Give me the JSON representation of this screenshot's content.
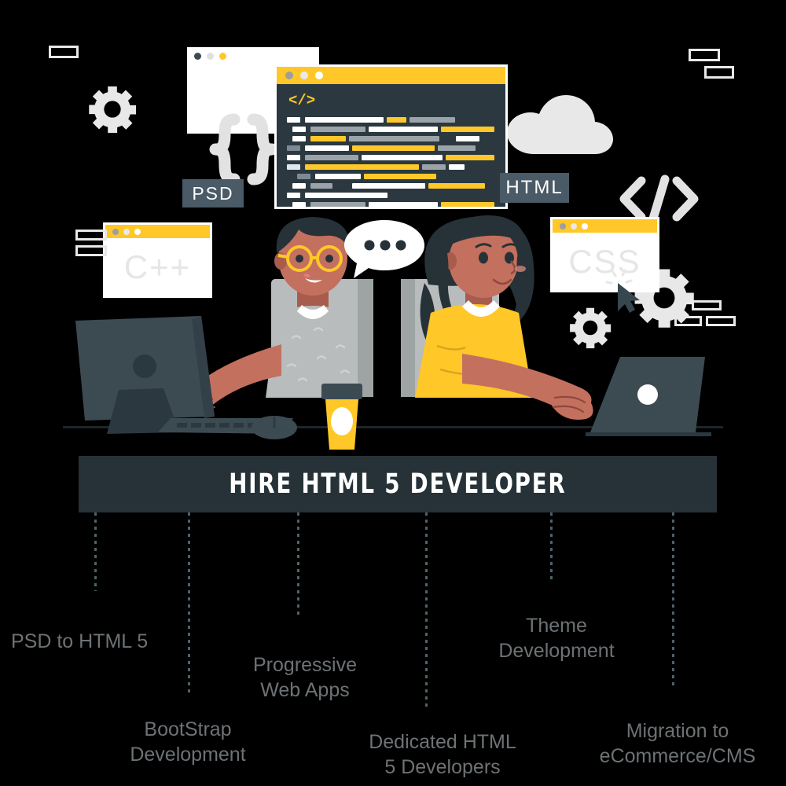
{
  "title_bar": {
    "text": "HIRE  HTML  5  DEVELOPER"
  },
  "badges": {
    "psd": "PSD",
    "html": "HTML"
  },
  "windows": {
    "cpp": {
      "watermark": "C++"
    },
    "css": {
      "watermark": "CSS"
    },
    "psd_window": {
      "watermark": ""
    }
  },
  "editor": {
    "tag": "</>"
  },
  "code_icon": {
    "glyph": "</>"
  },
  "services": [
    {
      "id": "psd-to-html5",
      "label": "PSD to HTML 5"
    },
    {
      "id": "bootstrap",
      "label": "BootStrap\nDevelopment"
    },
    {
      "id": "progressive-web",
      "label": "Progressive\nWeb Apps"
    },
    {
      "id": "dedicated-devs",
      "label": "Dedicated HTML\n5 Developers"
    },
    {
      "id": "theme-dev",
      "label": "Theme\nDevelopment"
    },
    {
      "id": "migration",
      "label": "Migration to\neCommerce/CMS"
    }
  ],
  "icons": {
    "gear_small_left": "gear-icon",
    "gear_right_large": "gear-icon",
    "gear_right_small": "gear-icon",
    "cloud": "cloud-icon",
    "braces": "curly-braces-icon",
    "cursor": "mouse-cursor-icon",
    "speech_bubble": "speech-bubble-icon",
    "laptop": "laptop-icon",
    "monitor": "monitor-icon",
    "keyboard": "keyboard-icon",
    "coffee_cup": "coffee-cup-icon",
    "mouse": "computer-mouse-icon"
  },
  "colors": {
    "background": "#000000",
    "accent_yellow": "#FFC727",
    "dark_slate": "#263238",
    "editor_bg": "#2b3840",
    "badge_bg": "#4a5a66",
    "label_grey": "#6d7275",
    "decor_grey": "#e8e8e8",
    "skin": "#c4705f",
    "hair": "#263238",
    "shirt_grey": "#b7b7b7",
    "shirt_yellow": "#FFC727"
  }
}
